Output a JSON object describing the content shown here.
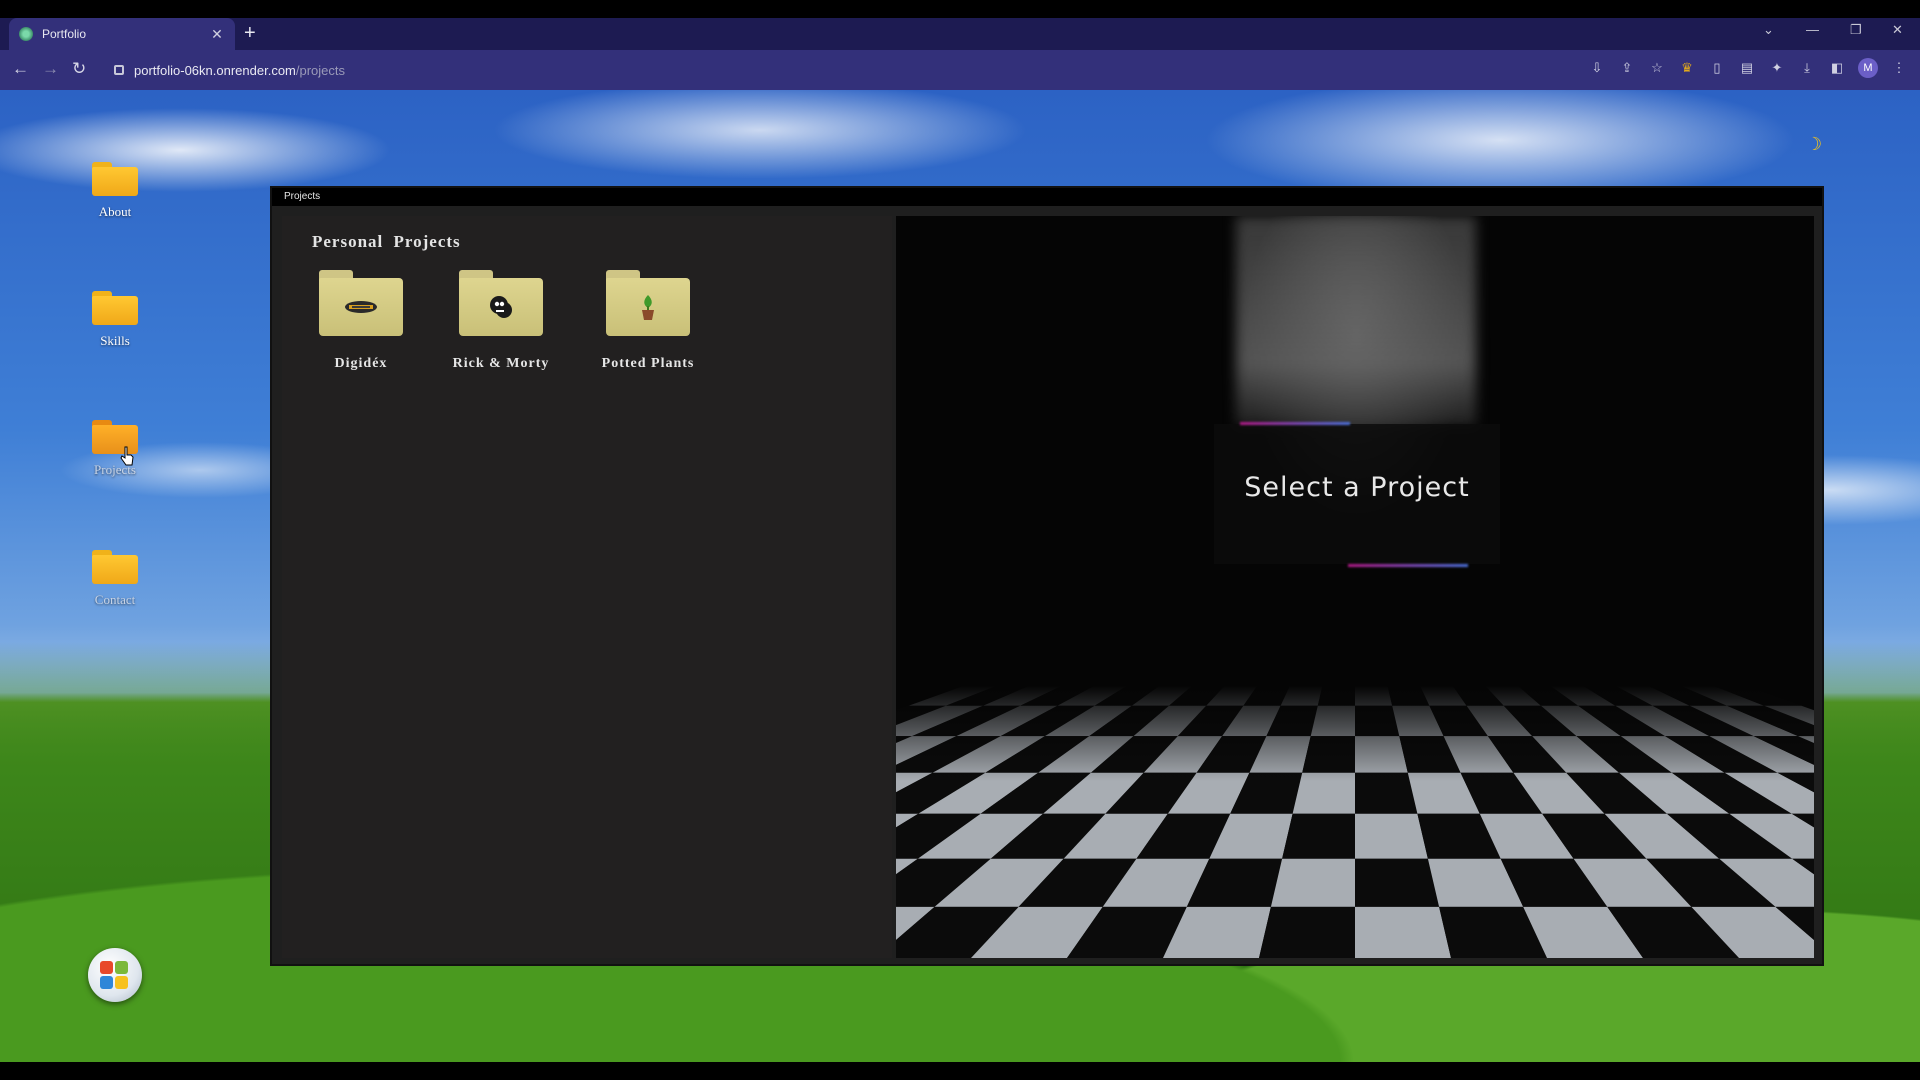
{
  "browser": {
    "tab_title": "Portfolio",
    "url_host": "portfolio-06kn.onrender.com",
    "url_path": "/projects",
    "profile_initial": "M"
  },
  "desktop": {
    "icons": [
      {
        "label": "About",
        "icon": "folder-icon"
      },
      {
        "label": "Skills",
        "icon": "folder-icon"
      },
      {
        "label": "Projects",
        "icon": "folder-open-icon"
      },
      {
        "label": "Contact",
        "icon": "folder-icon"
      }
    ],
    "theme_toggle_icon": "moon-icon",
    "start_button_icon": "windows-logo-icon"
  },
  "window": {
    "title": "Projects",
    "section_title": "Personal Projects",
    "projects": [
      {
        "label": "Digidéx",
        "icon": "digimon-logo-icon"
      },
      {
        "label": "Rick & Morty",
        "icon": "rick-morty-icon"
      },
      {
        "label": "Potted Plants",
        "icon": "potted-plant-icon"
      }
    ],
    "detail_message": "Select a Project"
  },
  "colors": {
    "tab_bar": "#1d1b52",
    "toolbar": "#33307a",
    "window_bg": "#1f1f1f",
    "folder_project": "#ded58f",
    "folder_desktop": "#ffc832",
    "accent_glow": "#b01a86"
  }
}
